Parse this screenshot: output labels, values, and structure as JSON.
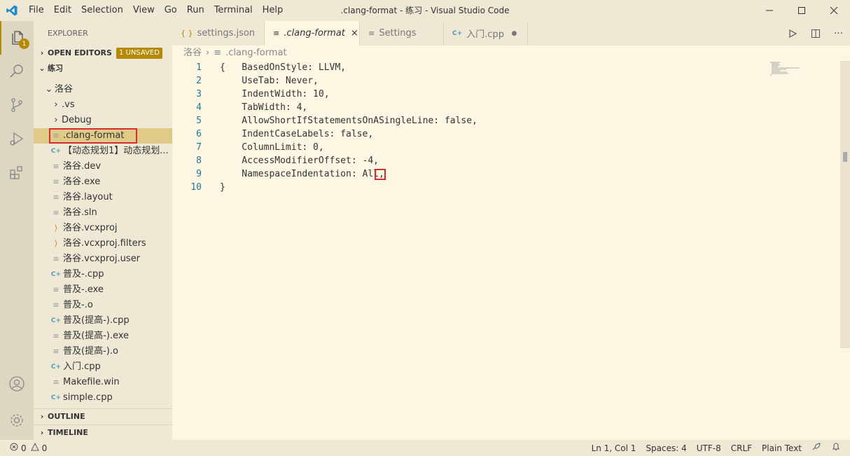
{
  "menu": [
    "File",
    "Edit",
    "Selection",
    "View",
    "Go",
    "Run",
    "Terminal",
    "Help"
  ],
  "window_title": ".clang-format - 练习 - Visual Studio Code",
  "activity": {
    "explorer_badge": "1"
  },
  "sidebar": {
    "title": "EXPLORER",
    "open_editors": "OPEN EDITORS",
    "unsaved_badge": "1 UNSAVED",
    "workspace": "练习",
    "folder": "洛谷",
    "items": [
      {
        "label": ".vs",
        "type": "folder"
      },
      {
        "label": "Debug",
        "type": "folder"
      },
      {
        "label": ".clang-format",
        "type": "lines",
        "selected": true
      },
      {
        "label": "【动态规划1】动态规划...",
        "type": "cpp"
      },
      {
        "label": "洛谷.dev",
        "type": "lines"
      },
      {
        "label": "洛谷.exe",
        "type": "lines"
      },
      {
        "label": "洛谷.layout",
        "type": "lines"
      },
      {
        "label": "洛谷.sln",
        "type": "lines"
      },
      {
        "label": "洛谷.vcxproj",
        "type": "rss"
      },
      {
        "label": "洛谷.vcxproj.filters",
        "type": "rss"
      },
      {
        "label": "洛谷.vcxproj.user",
        "type": "lines"
      },
      {
        "label": "普及-.cpp",
        "type": "cpp"
      },
      {
        "label": "普及-.exe",
        "type": "lines"
      },
      {
        "label": "普及-.o",
        "type": "lines"
      },
      {
        "label": "普及(提高-).cpp",
        "type": "cpp"
      },
      {
        "label": "普及(提高-).exe",
        "type": "lines"
      },
      {
        "label": "普及(提高-).o",
        "type": "lines"
      },
      {
        "label": "入门.cpp",
        "type": "cpp"
      },
      {
        "label": "Makefile.win",
        "type": "lines"
      },
      {
        "label": "simple.cpp",
        "type": "cpp"
      }
    ],
    "outline": "OUTLINE",
    "timeline": "TIMELINE"
  },
  "tabs": [
    {
      "label": "settings.json",
      "icon": "{ }",
      "italic": false
    },
    {
      "label": ".clang-format",
      "icon": "≡",
      "italic": true,
      "active": true
    },
    {
      "label": "Settings",
      "icon": "≡",
      "italic": false
    },
    {
      "label": "入门.cpp",
      "icon": "C+",
      "italic": false,
      "dirty": true
    }
  ],
  "breadcrumb": {
    "folder": "洛谷",
    "file": ".clang-format"
  },
  "code": [
    "{   BasedOnStyle: LLVM,",
    "    UseTab: Never,",
    "    IndentWidth: 10,",
    "    TabWidth: 4,",
    "    AllowShortIfStatementsOnASingleLine: false,",
    "    IndentCaseLabels: false,",
    "    ColumnLimit: 0,",
    "    AccessModifierOffset: -4,",
    "    NamespaceIndentation: All,",
    "}"
  ],
  "status": {
    "errors": "0",
    "warnings": "0",
    "position": "Ln 1, Col 1",
    "spaces": "Spaces: 4",
    "encoding": "UTF-8",
    "eol": "CRLF",
    "language": "Plain Text"
  },
  "colors": {
    "accent": "#b58900",
    "highlight_box": "#d32f2f",
    "cpp_icon": "#519aba",
    "rss_icon": "#e37933"
  }
}
